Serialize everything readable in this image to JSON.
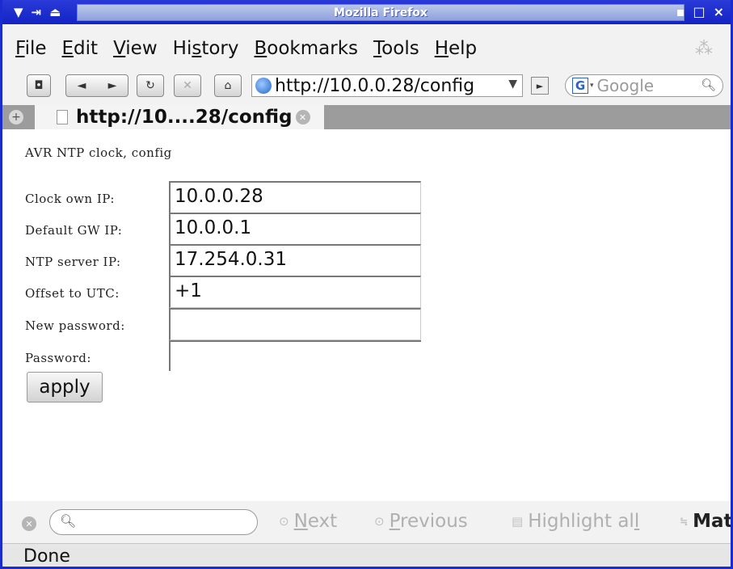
{
  "window": {
    "title": "Mozilla Firefox",
    "left_controls": [
      "▼",
      "⇥",
      "⏏"
    ],
    "right_controls": [
      "▪",
      "□",
      "×"
    ]
  },
  "menu": {
    "items": [
      {
        "label": "File",
        "underline_index": 0
      },
      {
        "label": "Edit",
        "underline_index": 0
      },
      {
        "label": "View",
        "underline_index": 0
      },
      {
        "label": "History",
        "underline_index": 2
      },
      {
        "label": "Bookmarks",
        "underline_index": 0
      },
      {
        "label": "Tools",
        "underline_index": 0
      },
      {
        "label": "Help",
        "underline_index": 0
      }
    ]
  },
  "navigation": {
    "buttons": [
      "◘",
      "◄",
      "►",
      "↻",
      "✕",
      "⌂"
    ],
    "url": "http://10.0.0.28/config",
    "search_engine_icon": "google-g-icon",
    "search_engine_letter": "G",
    "search_placeholder": "Google"
  },
  "tab": {
    "label": "http://10....28/config"
  },
  "page": {
    "heading": "AVR NTP clock, config",
    "fields": [
      {
        "label": "Clock own IP:",
        "value": "10.0.0.28"
      },
      {
        "label": "Default GW IP:",
        "value": "10.0.0.1"
      },
      {
        "label": "NTP server IP:",
        "value": "17.254.0.31"
      },
      {
        "label": "Offset to UTC:",
        "value": "+1"
      },
      {
        "label": "New password:",
        "value": ""
      },
      {
        "label": "Password:",
        "value": ""
      }
    ],
    "apply_label": "apply"
  },
  "findbar": {
    "next_label": "Next",
    "previous_label": "Previous",
    "highlight_label": "Highlight all",
    "match_label": "Mat"
  },
  "status": {
    "text": "Done"
  }
}
